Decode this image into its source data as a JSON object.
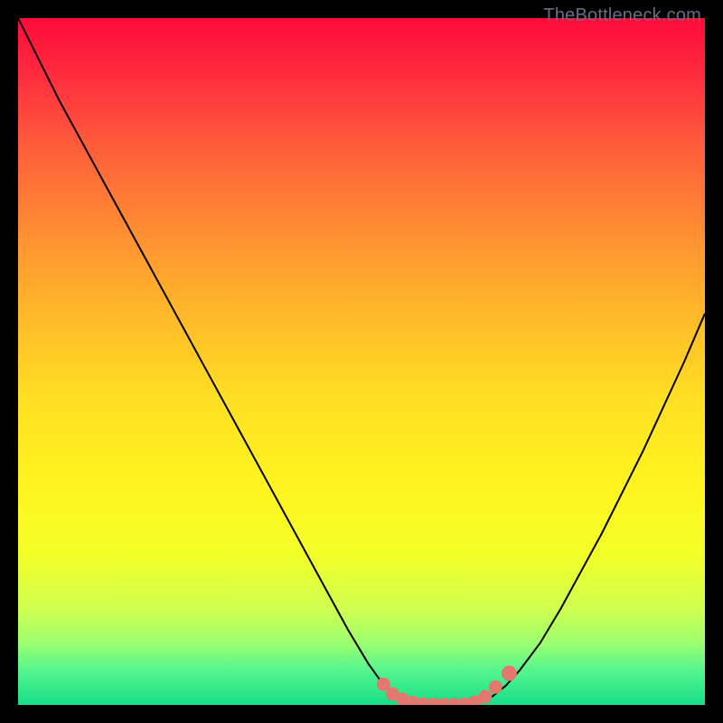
{
  "credit_text": "TheBottleneck.com",
  "colors": {
    "frame": "#000000",
    "curve": "#000000",
    "marker_fill": "#e3786f",
    "marker_stroke": "#e3786f"
  },
  "chart_data": {
    "type": "line",
    "title": "",
    "xlabel": "",
    "ylabel": "",
    "xlim": [
      0,
      100
    ],
    "ylim": [
      0,
      100
    ],
    "series": [
      {
        "name": "bottleneck-curve",
        "x": [
          0,
          3,
          6,
          9,
          12,
          15,
          18,
          21,
          24,
          27,
          30,
          33,
          36,
          39,
          42,
          45,
          48,
          51,
          53,
          55,
          57,
          59,
          61,
          63,
          65,
          67,
          69,
          71,
          73,
          76,
          79,
          82,
          85,
          88,
          91,
          94,
          97,
          100
        ],
        "y": [
          100,
          94,
          88,
          82.5,
          77,
          71.5,
          66,
          60.5,
          55,
          49.5,
          44,
          38.5,
          33,
          27.5,
          22,
          16.5,
          11,
          6,
          3.2,
          1.5,
          0.6,
          0.15,
          0.05,
          0.05,
          0.1,
          0.4,
          1.2,
          2.8,
          5,
          9,
          14,
          19.5,
          25,
          31,
          37,
          43.5,
          50,
          57
        ],
        "note": "Values are estimated from the rendered curve; y is percentage bottleneck, x is a normalized horizontal axis."
      }
    ],
    "markers": {
      "name": "bottom-marker-band",
      "note": "Highlighted points along the curve near its minimum, drawn as salmon dots.",
      "x": [
        53.2,
        54.5,
        56,
        57.5,
        59,
        60.5,
        62,
        63.5,
        65,
        66.5,
        68,
        69.5,
        71.5
      ],
      "y": [
        3.0,
        1.6,
        0.8,
        0.35,
        0.12,
        0.05,
        0.03,
        0.05,
        0.12,
        0.4,
        1.2,
        2.6,
        4.6
      ],
      "r": [
        7,
        7,
        7,
        7,
        7,
        7,
        7,
        7,
        7,
        7,
        7,
        7,
        8
      ]
    },
    "gradient_stops": [
      {
        "offset": 0.0,
        "color": "#ff0a3a"
      },
      {
        "offset": 0.08,
        "color": "#ff2b3e"
      },
      {
        "offset": 0.18,
        "color": "#ff5a3b"
      },
      {
        "offset": 0.3,
        "color": "#ff8a33"
      },
      {
        "offset": 0.42,
        "color": "#ffb52a"
      },
      {
        "offset": 0.55,
        "color": "#ffde23"
      },
      {
        "offset": 0.68,
        "color": "#fff41f"
      },
      {
        "offset": 0.78,
        "color": "#f4ff27"
      },
      {
        "offset": 0.86,
        "color": "#cfff4f"
      },
      {
        "offset": 0.91,
        "color": "#9cff6f"
      },
      {
        "offset": 0.95,
        "color": "#55f58e"
      },
      {
        "offset": 1.0,
        "color": "#17de87"
      }
    ]
  }
}
